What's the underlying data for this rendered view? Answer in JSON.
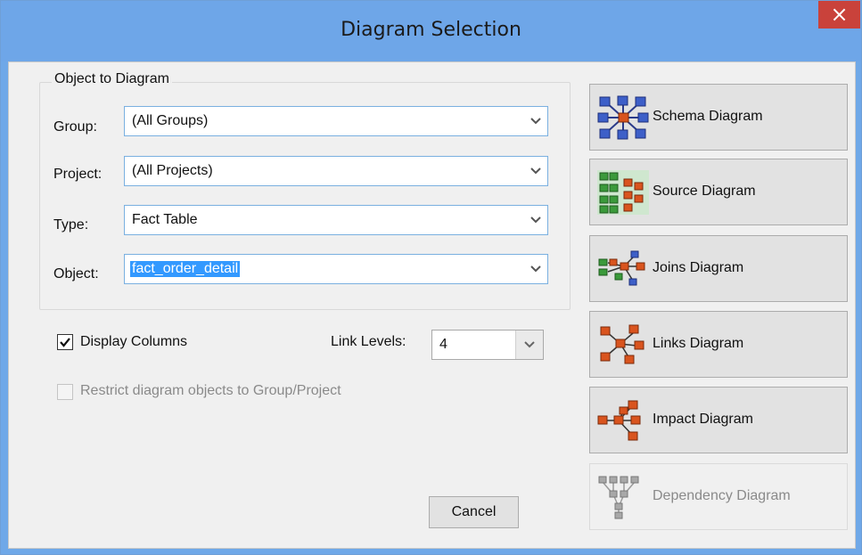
{
  "window": {
    "title": "Diagram Selection",
    "close_glyph": "×"
  },
  "object_group": {
    "legend": "Object to Diagram",
    "fields": [
      {
        "label": "Group:",
        "value": "(All Groups)"
      },
      {
        "label": "Project:",
        "value": "(All Projects)"
      },
      {
        "label": "Type:",
        "value": "Fact Table"
      },
      {
        "label": "Object:",
        "value": "fact_order_detail"
      }
    ]
  },
  "options": {
    "display_columns": {
      "label": "Display Columns",
      "checked": true
    },
    "link_levels": {
      "label": "Link Levels:",
      "value": "4"
    },
    "restrict": {
      "label": "Restrict diagram objects to Group/Project",
      "checked": false,
      "enabled": false
    }
  },
  "buttons": {
    "cancel": "Cancel",
    "diagrams": [
      {
        "label": "Schema Diagram",
        "icon": "schema-diagram-icon",
        "enabled": true
      },
      {
        "label": "Source Diagram",
        "icon": "source-diagram-icon",
        "enabled": true
      },
      {
        "label": "Joins Diagram",
        "icon": "joins-diagram-icon",
        "enabled": true
      },
      {
        "label": "Links Diagram",
        "icon": "links-diagram-icon",
        "enabled": true
      },
      {
        "label": "Impact Diagram",
        "icon": "impact-diagram-icon",
        "enabled": true
      },
      {
        "label": "Dependency Diagram",
        "icon": "dependency-diagram-icon",
        "enabled": false
      }
    ]
  },
  "colors": {
    "titlebar": "#6ea6e8",
    "close": "#c9423b",
    "selection": "#3399ff",
    "node_blue": "#3d5fc8",
    "node_orange": "#d9541e",
    "node_green": "#3b9a3b",
    "node_gray": "#8c8c8c"
  }
}
